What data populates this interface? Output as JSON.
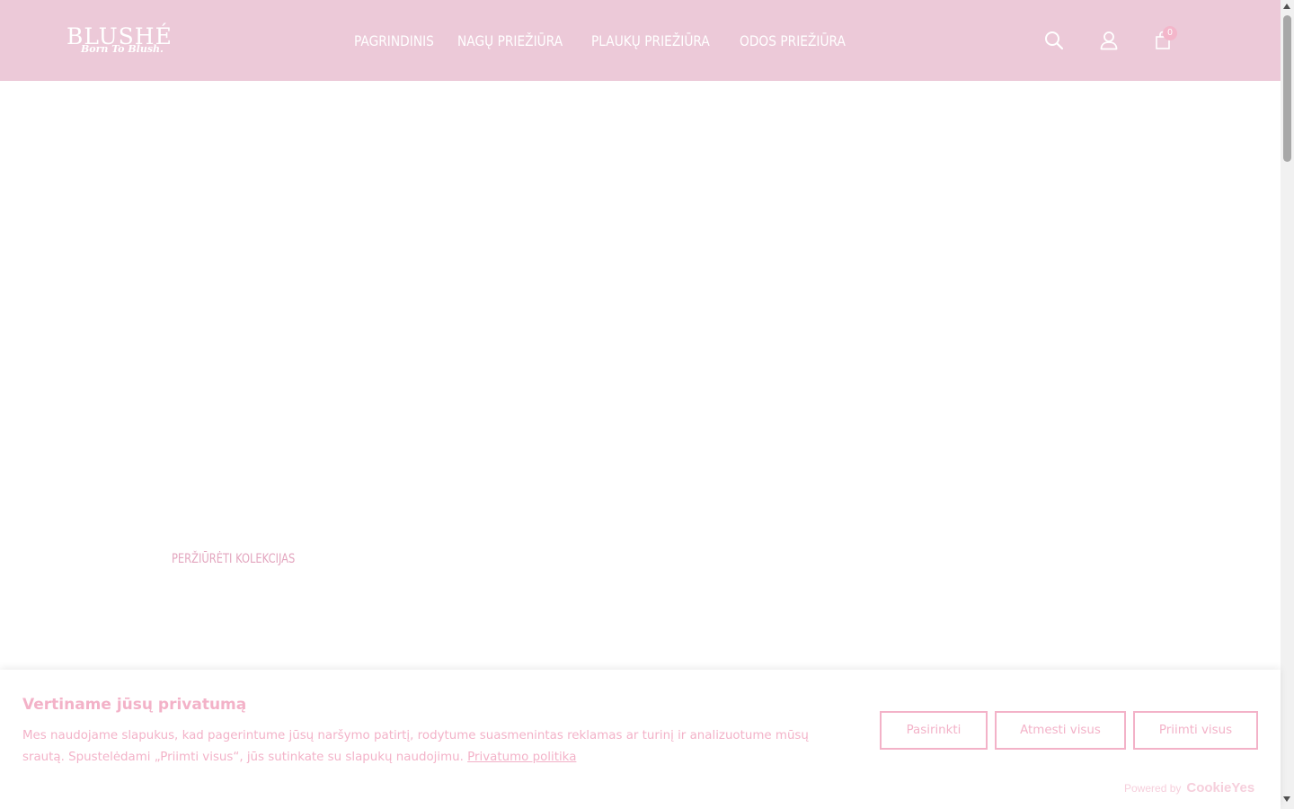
{
  "header": {
    "logo": {
      "name": "BLUSHÉ",
      "tagline": "Born To Blush."
    },
    "nav": [
      {
        "label": "PAGRINDINIS"
      },
      {
        "label": "NAGŲ PRIEŽIŪRA"
      },
      {
        "label": "PLAUKŲ PRIEŽIŪRA"
      },
      {
        "label": "ODOS PRIEŽIŪRA"
      }
    ],
    "icons": {
      "search": "search-icon",
      "account": "user-icon",
      "cart": "shopping-bag-icon"
    },
    "cart_count": "0"
  },
  "hero": {
    "cta_label": "PERŽIŪRĖTI KOLEKCIJAS"
  },
  "cookie_banner": {
    "title": "Vertiname jūsų privatumą",
    "text": "Mes naudojame slapukus, kad pagerintume jūsų naršymo patirtį, rodytume suasmenintas reklamas ar turinį ir analizuotume mūsų srautą. Spustelėdami „Priimti visus“, jūs sutinkate su slapukų naudojimu.",
    "policy_link": "Privatumo politika",
    "buttons": {
      "customize": "Pasirinkti",
      "reject": "Atmesti visus",
      "accept": "Priimti visus"
    },
    "powered_by_label": "Powered by",
    "powered_by_brand": "CookieYes"
  },
  "colors": {
    "header_bg": "#ecc9d8",
    "accent_pink": "#f3b2c8",
    "link_pink": "#e3a6bf"
  }
}
